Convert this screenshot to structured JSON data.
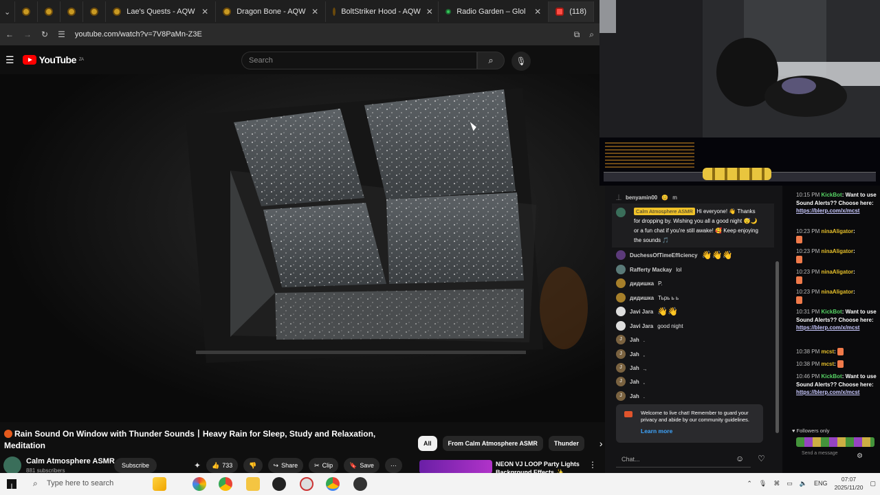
{
  "browser": {
    "tabs": [
      {
        "label": "",
        "icon": "aqw"
      },
      {
        "label": "",
        "icon": "aqw"
      },
      {
        "label": "",
        "icon": "aqw"
      },
      {
        "label": "",
        "icon": "aqw"
      },
      {
        "label": "Lae's Quests - AQW",
        "icon": "aqw"
      },
      {
        "label": "Dragon Bone - AQW",
        "icon": "aqw"
      },
      {
        "label": "BoltStriker Hood - AQW",
        "icon": "aqw"
      },
      {
        "label": "Radio Garden – Glol",
        "icon": "radio"
      },
      {
        "label": "(118)",
        "icon": "youtube"
      }
    ],
    "url": "youtube.com/watch?v=7V8PaMn-Z3E"
  },
  "youtube": {
    "logo_text": "YouTube",
    "logo_region": "ZA",
    "search_placeholder": "Search",
    "video_title": "Rain Sound On Window with Thunder Sounds丨Heavy Rain for Sleep, Study and Relaxation, Meditation",
    "channel_name": "Calm Atmosphere ASMR",
    "subscribers": "881 subscribers",
    "subscribe_label": "Subscribe",
    "like_count": "733",
    "share_label": "Share",
    "clip_label": "Clip",
    "save_label": "Save",
    "chips": [
      "All",
      "From Calm Atmosphere ASMR",
      "Thunder"
    ],
    "rec_title": "NEON VJ LOOP Party Lights Background Effects ✨ Strobe"
  },
  "live_chat": {
    "messages": [
      {
        "name": "benyamin00",
        "text": "m"
      },
      {
        "name": "DuchessOfTimeEfficiency",
        "text": ""
      },
      {
        "name": "Rafferty Mackay",
        "text": "lol"
      },
      {
        "name": "дидишка",
        "text": "P."
      },
      {
        "name": "дидишка",
        "text": "Тьрь ь ь"
      },
      {
        "name": "Javi Jara",
        "text": ""
      },
      {
        "name": "Javi Jara",
        "text": "good night"
      },
      {
        "name": "Jah",
        "text": "."
      },
      {
        "name": "Jah",
        "text": ","
      },
      {
        "name": "Jah",
        "text": ".,"
      },
      {
        "name": "Jah",
        "text": ","
      },
      {
        "name": "Jah",
        "text": "."
      }
    ],
    "highlight_name": "Calm Atmosphere ASMR",
    "highlight_text": "Hi everyone! 👋 Thanks for dropping by. Wishing you all a good night 😴🌙 or a fun chat if you're still awake! 🥰 Keep enjoying the sounds 🎵",
    "notice_text": "Welcome to live chat! Remember to guard your privacy and abide by our community guidelines.",
    "notice_link": "Learn more",
    "input_placeholder": "Chat..."
  },
  "kick_chat": {
    "messages": [
      {
        "time": "10:15 PM",
        "name": "KickBot",
        "text": "Want to use Sound Alerts?? Choose here:",
        "link": "https://blerp.com/x/mcst"
      },
      {
        "time": "10:23 PM",
        "name": "ninaAligator",
        "text": ""
      },
      {
        "time": "10:23 PM",
        "name": "ninaAligator",
        "text": ""
      },
      {
        "time": "10:23 PM",
        "name": "ninaAligator",
        "text": ""
      },
      {
        "time": "10:23 PM",
        "name": "ninaAligator",
        "text": ""
      },
      {
        "time": "10:31 PM",
        "name": "KickBot",
        "text": "Want to use Sound Alerts?? Choose here:",
        "link": "https://blerp.com/x/mcst"
      },
      {
        "time": "10:38 PM",
        "name": "mcst",
        "text": ""
      },
      {
        "time": "10:38 PM",
        "name": "mcst",
        "text": ""
      },
      {
        "time": "10:46 PM",
        "name": "KickBot",
        "text": "Want to use Sound Alerts?? Choose here:",
        "link": "https://blerp.com/x/mcst"
      }
    ],
    "followers_only": "Followers only",
    "send_placeholder": "Send a message"
  },
  "taskbar": {
    "search_placeholder": "Type here to search",
    "language": "ENG",
    "time": "07:07",
    "date": "2025/11/20"
  }
}
